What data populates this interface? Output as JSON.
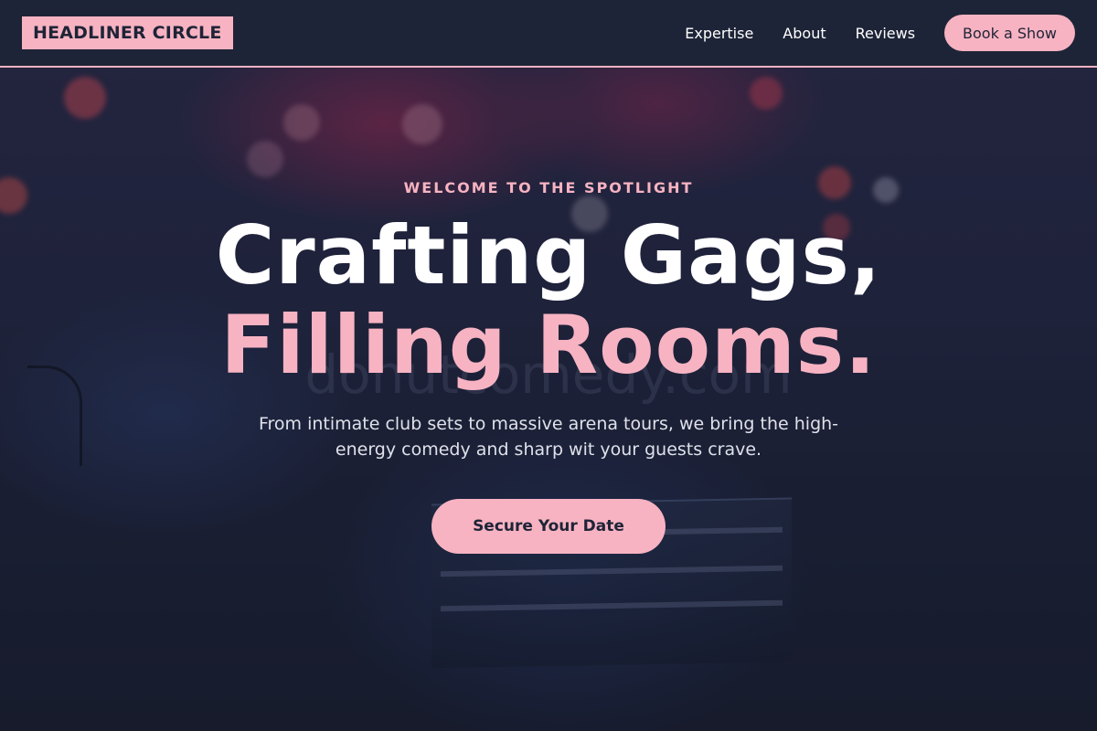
{
  "brand": {
    "name": "HEADLINER CIRCLE"
  },
  "nav": {
    "links": [
      "Expertise",
      "About",
      "Reviews"
    ],
    "cta_label": "Book a Show"
  },
  "hero": {
    "eyebrow": "WELCOME TO THE SPOTLIGHT",
    "headline_line1": "Crafting Gags,",
    "headline_line2": "Filling Rooms.",
    "subtitle": "From intimate club sets to massive arena tours, we bring the high-energy comedy and sharp wit your guests crave.",
    "cta_label": "Secure Your Date",
    "watermark": "donutcomedy.com"
  },
  "colors": {
    "accent": "#f7b3c2",
    "header_bg": "#1e2437",
    "text_primary": "#ffffff",
    "text_muted": "#dfe1ea"
  }
}
